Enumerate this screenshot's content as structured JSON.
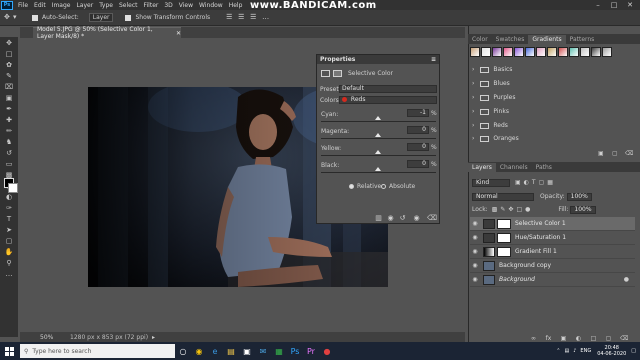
{
  "menubar": {
    "items": [
      "File",
      "Edit",
      "Image",
      "Layer",
      "Type",
      "Select",
      "Filter",
      "3D",
      "View",
      "Window",
      "Help"
    ],
    "logo": "Ps",
    "watermark": "www.BANDICAM.com"
  },
  "options": {
    "auto_select_label": "Auto-Select:",
    "auto_select_target": "Layer",
    "transform_label": "Show Transform Controls"
  },
  "document": {
    "tab_title": "Model 5.JPG @ 50% (Selective Color 1, Layer Mask/8) *",
    "zoom": "50%",
    "size_info": "1280 px x 853 px (72 ppi)"
  },
  "properties": {
    "panel_title": "Properties",
    "adjustment_title": "Selective Color",
    "preset_label": "Preset:",
    "preset_value": "Default",
    "colors_label": "Colors:",
    "colors_value": "Reds",
    "sliders": [
      {
        "label": "Cyan:",
        "value": "-1",
        "percent": "%"
      },
      {
        "label": "Magenta:",
        "value": "0",
        "percent": "%"
      },
      {
        "label": "Yellow:",
        "value": "0",
        "percent": "%"
      },
      {
        "label": "Black:",
        "value": "0",
        "percent": "%"
      }
    ],
    "method_relative": "Relative",
    "method_absolute": "Absolute",
    "method_selected": "Relative"
  },
  "top_right": {
    "tabs": [
      "Color",
      "Swatches",
      "Gradients",
      "Patterns"
    ],
    "active_tab": "Gradients",
    "gradient_colors": [
      "#c7a27a",
      "#e0e0e0",
      "#7a3b9a",
      "#e05a8a",
      "#8a5ad8",
      "#4a6ad8",
      "#e0a0c0",
      "#c0a060",
      "#d05050",
      "#60c0b0",
      "#c0c0c0",
      "#404040",
      "#a0a0a0"
    ],
    "folders": [
      "Basics",
      "Blues",
      "Purples",
      "Pinks",
      "Reds",
      "Oranges"
    ]
  },
  "layers": {
    "tabs": [
      "Layers",
      "Channels",
      "Paths"
    ],
    "active_tab": "Layers",
    "kind_label": "Kind",
    "blend_mode": "Normal",
    "opacity_label": "Opacity:",
    "opacity_value": "100%",
    "lock_label": "Lock:",
    "fill_label": "Fill:",
    "fill_value": "100%",
    "items": [
      {
        "name": "Selective Color 1",
        "selected": true,
        "type": "adjustment"
      },
      {
        "name": "Hue/Saturation 1",
        "selected": false,
        "type": "adjustment"
      },
      {
        "name": "Gradient Fill 1",
        "selected": false,
        "type": "gradient"
      },
      {
        "name": "Background copy",
        "selected": false,
        "type": "photo"
      },
      {
        "name": "Background",
        "selected": false,
        "type": "photo"
      }
    ]
  },
  "taskbar": {
    "search_placeholder": "Type here to search",
    "tray_lang": "ENG",
    "time": "20:48",
    "date": "04-06-2020"
  },
  "colors": {
    "accent_red": "#d42a1e",
    "panel": "#535353",
    "dark": "#323232"
  }
}
